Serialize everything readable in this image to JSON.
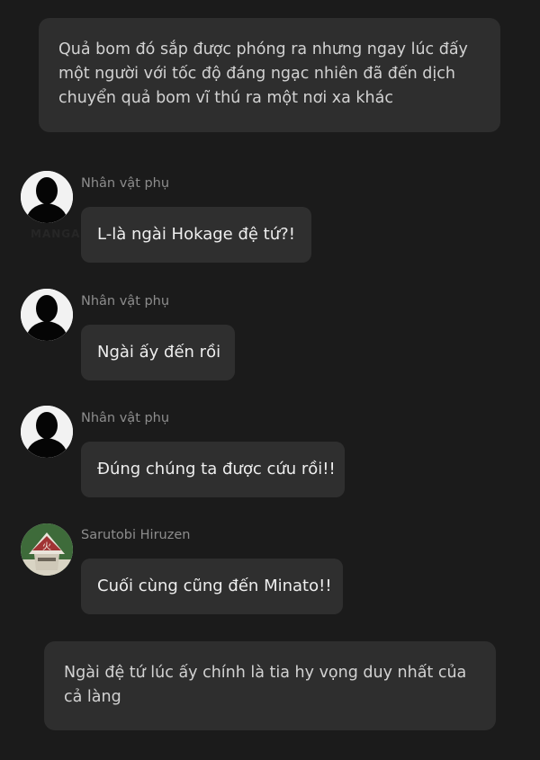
{
  "narrations": [
    "Quả bom đó sắp được phóng ra nhưng ngay lúc đấy một người với tốc độ đáng ngạc nhiên đã đến dịch chuyển quả bom vĩ thú ra một nơi xa khác",
    "Ngài đệ tứ lúc ấy chính là tia hy vọng duy nhất của cả làng"
  ],
  "messages": [
    {
      "sender": "Nhân vật phụ",
      "text": "L-là ngài Hokage đệ tứ?!",
      "avatar_icon": "silhouette-avatar-icon"
    },
    {
      "sender": "Nhân vật phụ",
      "text": "Ngài ấy đến rồi",
      "avatar_icon": "silhouette-avatar-icon"
    },
    {
      "sender": "Nhân vật phụ",
      "text": "Đúng chúng ta được cứu rồi!!",
      "avatar_icon": "silhouette-avatar-icon"
    },
    {
      "sender": "Sarutobi Hiruzen",
      "text": "Cuối cùng cũng đến Minato!!",
      "avatar_icon": "hokage-hat-avatar-icon"
    }
  ],
  "watermark": "MANGA.G",
  "colors": {
    "background": "#1b1b1b",
    "bubble": "#2f2f2f",
    "narration": "#2e2e2e",
    "sender_text": "#8d8d8d"
  }
}
